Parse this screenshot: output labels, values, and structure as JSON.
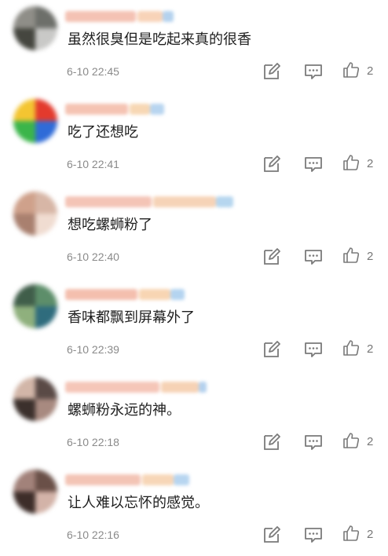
{
  "comments": [
    {
      "text": "虽然很臭但是吃起来真的很香",
      "time": "6-10 22:45",
      "likes": "2",
      "avatar_colors": [
        "#6d6f6a",
        "#c9c9c7",
        "#45463f",
        "#8f8e88"
      ],
      "name_colors": [
        "#f4c2b4",
        "#f8d3b8",
        "#b4d2ee"
      ]
    },
    {
      "text": "吃了还想吃",
      "time": "6-10 22:41",
      "likes": "2",
      "avatar_colors": [
        "#e33a2d",
        "#2f6bd8",
        "#3bb54a",
        "#f4c531"
      ],
      "name_colors": [
        "#f5c3b3",
        "#f7d7b4",
        "#b8d5f0"
      ]
    },
    {
      "text": "想吃螺蛳粉了",
      "time": "6-10 22:40",
      "likes": "2",
      "avatar_colors": [
        "#d7b6a6",
        "#f0dcd1",
        "#a9806f",
        "#cfa18b"
      ],
      "name_colors": [
        "#f4c4b6",
        "#f6d3b7",
        "#b6d6ef"
      ]
    },
    {
      "text": "香味都飘到屏幕外了",
      "time": "6-10 22:39",
      "likes": "2",
      "avatar_colors": [
        "#5d8e6a",
        "#2f6c7d",
        "#8fb07d",
        "#405e4a"
      ],
      "name_colors": [
        "#f4bfae",
        "#f8d5b3",
        "#b4d4f0"
      ]
    },
    {
      "text": "螺蛳粉永远的神。",
      "time": "6-10 22:18",
      "likes": "2",
      "avatar_colors": [
        "#5a4a46",
        "#a88a80",
        "#3b302c",
        "#d2b6a8"
      ],
      "name_colors": [
        "#f5c6b8",
        "#f6d2b5",
        "#b4d1ee"
      ]
    },
    {
      "text": "让人难以忘怀的感觉。",
      "time": "6-10 22:16",
      "likes": "2",
      "avatar_colors": [
        "#6a5048",
        "#d3b3a8",
        "#3d2d29",
        "#a2827a"
      ],
      "name_colors": [
        "#f3c4b5",
        "#f7d6b7",
        "#b7d5f0"
      ]
    }
  ],
  "icons": {
    "edit": "edit-icon",
    "reply": "reply-icon",
    "like": "thumbs-up-icon"
  },
  "colors": {
    "time": "#8a8a8a",
    "icon": "#7a7a7a",
    "text": "#1e1e1e"
  }
}
